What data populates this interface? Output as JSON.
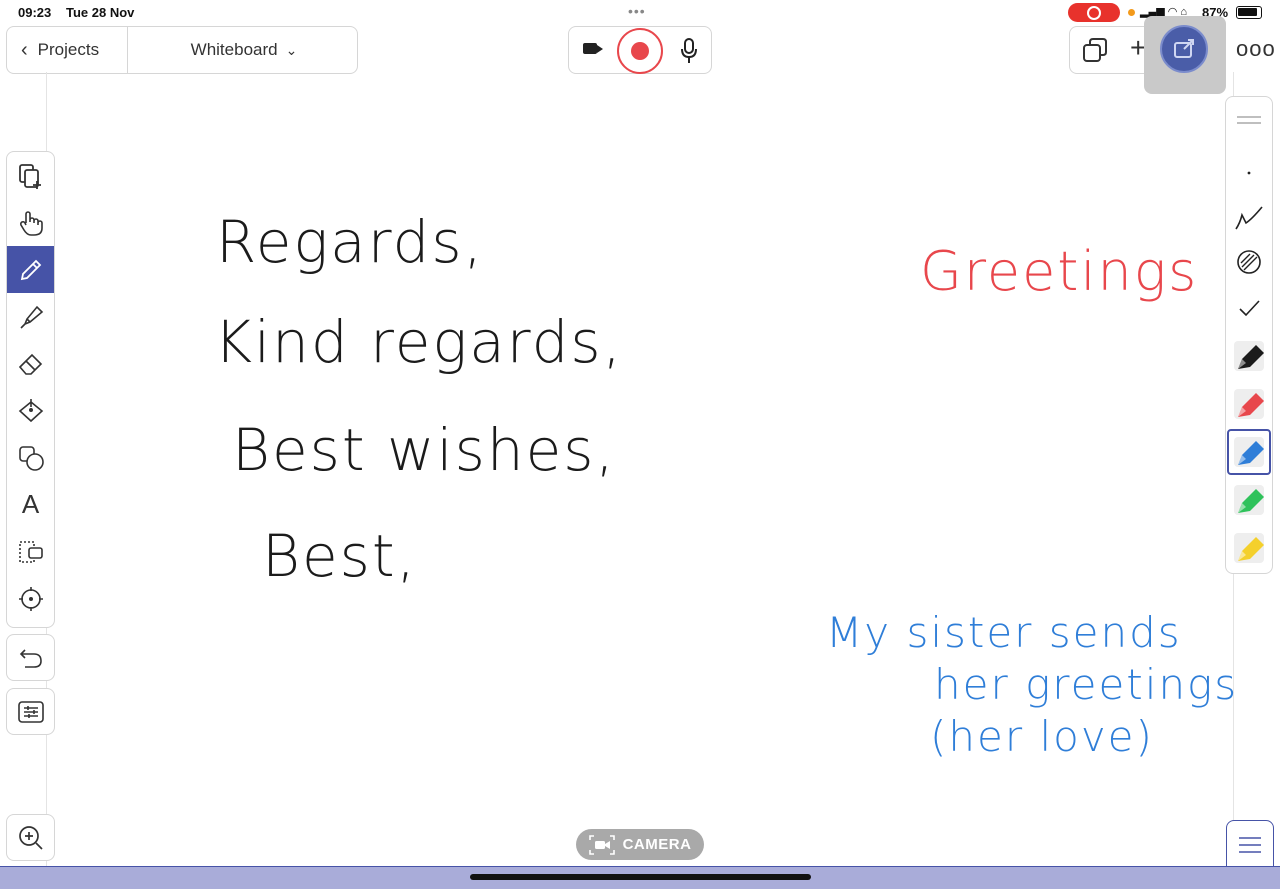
{
  "status_bar": {
    "time": "09:23",
    "date": "Tue 28 Nov",
    "battery": "87%"
  },
  "top_bar": {
    "back_label": "Projects",
    "doc_title": "Whiteboard"
  },
  "left_toolbar": {
    "tools": [
      {
        "icon": "add-page-icon"
      },
      {
        "icon": "hand-icon"
      },
      {
        "icon": "pen-icon",
        "active": true
      },
      {
        "icon": "highlighter-icon"
      },
      {
        "icon": "eraser-icon"
      },
      {
        "icon": "fill-icon"
      },
      {
        "icon": "shapes-icon"
      },
      {
        "icon": "text-icon",
        "glyph": "A"
      },
      {
        "icon": "select-icon"
      },
      {
        "icon": "laser-pointer-icon"
      }
    ]
  },
  "right_palette": {
    "selected_color": "#2f7ed8",
    "colors": [
      "#1b1b1b",
      "#e8474c",
      "#2f7ed8",
      "#2fc25b",
      "#f4d02c"
    ]
  },
  "canvas": {
    "black_lines": [
      "Regards,",
      "Kind regards,",
      "Best wishes,",
      "Best,"
    ],
    "red_text": "Greetings",
    "blue_lines": [
      "My sister sends",
      "her greetings",
      "(her love)"
    ]
  },
  "camera_label": "CAMERA",
  "accent_color": "#4653a7"
}
